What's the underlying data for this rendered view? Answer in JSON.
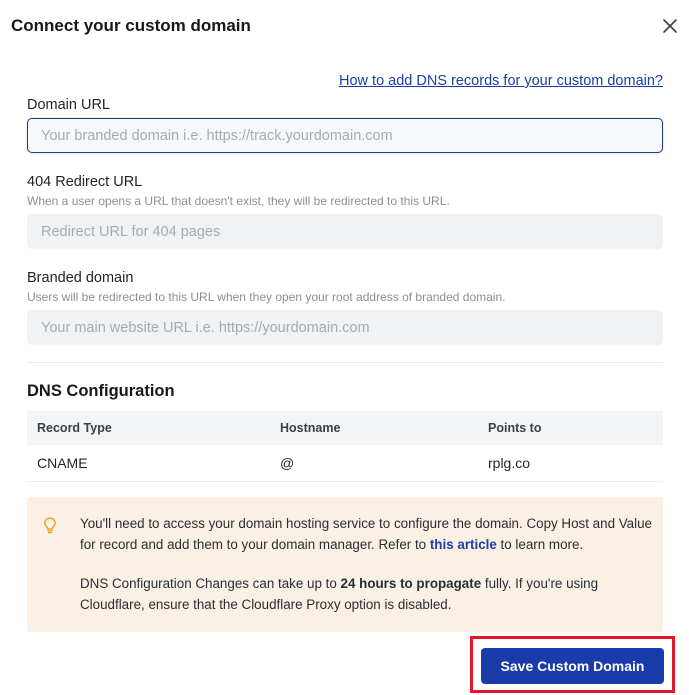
{
  "modal": {
    "title": "Connect your custom domain",
    "help_link": "How to add DNS records for your custom domain?"
  },
  "fields": {
    "domain_url": {
      "label": "Domain URL",
      "placeholder": "Your branded domain i.e. https://track.yourdomain.com",
      "value": ""
    },
    "redirect_404": {
      "label": "404 Redirect URL",
      "help": "When a user opens a URL that doesn't exist, they will be redirected to this URL.",
      "placeholder": "Redirect URL for 404 pages",
      "value": ""
    },
    "branded_domain": {
      "label": "Branded domain",
      "help": "Users will be redirected to this URL when they open your root address of branded domain.",
      "placeholder": "Your main website URL i.e. https://yourdomain.com",
      "value": ""
    }
  },
  "dns": {
    "title": "DNS Configuration",
    "headers": [
      "Record Type",
      "Hostname",
      "Points to"
    ],
    "rows": [
      [
        "CNAME",
        "@",
        "rplg.co"
      ]
    ]
  },
  "notice": {
    "p1_before": "You'll need to access your domain hosting service to configure the domain. Copy Host and Value for record and add them to your domain manager. Refer to ",
    "p1_link": "this article",
    "p1_after": " to learn more.",
    "p2_before": "DNS Configuration Changes can take up to ",
    "p2_strong": "24 hours to propagate",
    "p2_after": " fully. If you're using Cloudflare, ensure that the Cloudflare Proxy option is disabled."
  },
  "actions": {
    "save_label": "Save Custom Domain"
  },
  "colors": {
    "primary": "#1a3cab",
    "link": "#1a3fa8",
    "notice_bg": "#fbf0e4",
    "highlight": "#e0192a",
    "bulb": "#e5a21e"
  }
}
